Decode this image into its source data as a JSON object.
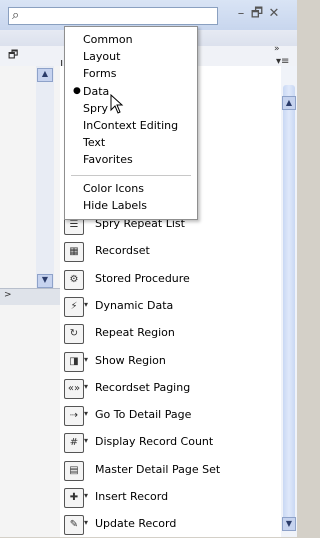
{
  "menu": {
    "items": [
      {
        "label": "Common",
        "selected": false
      },
      {
        "label": "Layout",
        "selected": false
      },
      {
        "label": "Forms",
        "selected": false
      },
      {
        "label": "Data",
        "selected": true
      },
      {
        "label": "Spry",
        "selected": false
      },
      {
        "label": "InContext Editing",
        "selected": false
      },
      {
        "label": "Text",
        "selected": false
      },
      {
        "label": "Favorites",
        "selected": false
      }
    ],
    "extra": [
      {
        "label": "Color Icons"
      },
      {
        "label": "Hide Labels"
      }
    ],
    "bullet": "●"
  },
  "panel": {
    "tab_label": "I",
    "menu_glyph": "▾≡"
  },
  "list": {
    "items": [
      {
        "label": "Spry Repeat List",
        "icon": "spry-repeat-list-icon",
        "dropdown": false
      },
      {
        "label": "Recordset",
        "icon": "recordset-icon",
        "dropdown": false
      },
      {
        "label": "Stored Procedure",
        "icon": "stored-procedure-icon",
        "dropdown": false
      },
      {
        "label": "Dynamic Data",
        "icon": "dynamic-data-icon",
        "dropdown": true
      },
      {
        "label": "Repeat Region",
        "icon": "repeat-region-icon",
        "dropdown": false
      },
      {
        "label": "Show Region",
        "icon": "show-region-icon",
        "dropdown": true
      },
      {
        "label": "Recordset Paging",
        "icon": "recordset-paging-icon",
        "dropdown": true
      },
      {
        "label": "Go To Detail Page",
        "icon": "go-to-detail-page-icon",
        "dropdown": true
      },
      {
        "label": "Display Record Count",
        "icon": "display-record-count-icon",
        "dropdown": true
      },
      {
        "label": "Master Detail Page Set",
        "icon": "master-detail-page-set-icon",
        "dropdown": false
      },
      {
        "label": "Insert Record",
        "icon": "insert-record-icon",
        "dropdown": true
      },
      {
        "label": "Update Record",
        "icon": "update-record-icon",
        "dropdown": true
      }
    ]
  },
  "colors": {
    "accent": "#c9d8f4",
    "menu_bg": "#ffffff"
  }
}
